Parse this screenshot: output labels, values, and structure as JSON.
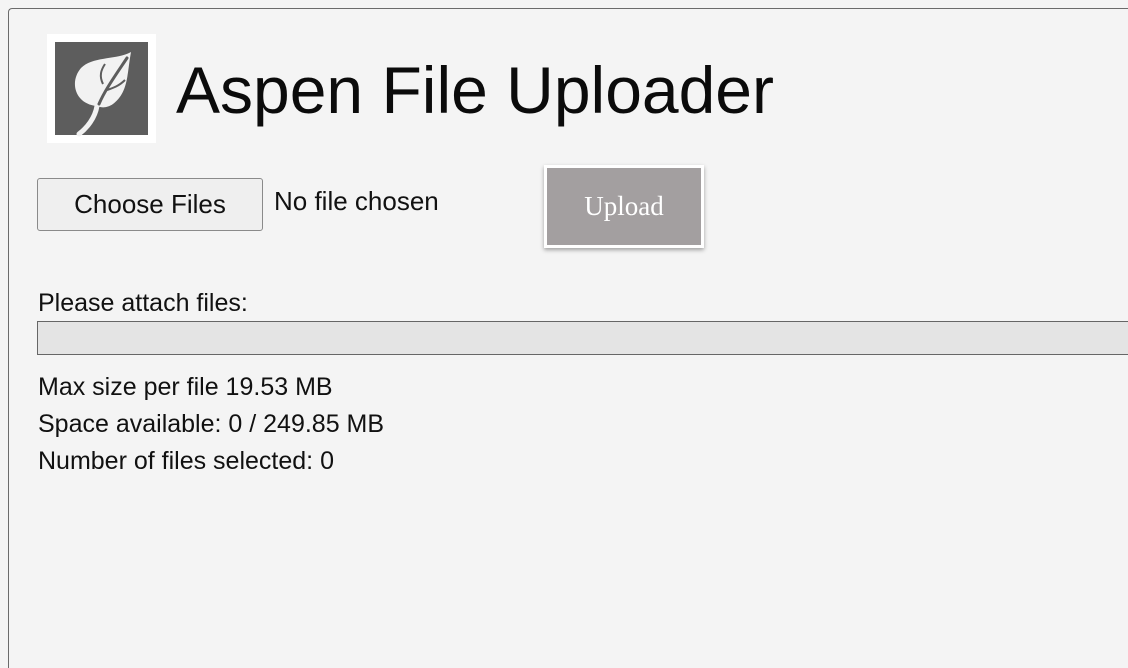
{
  "header": {
    "logo_icon": "aspen-leaf-icon",
    "title": "Aspen File Uploader"
  },
  "file_input": {
    "button_label": "Choose Files",
    "status_text": "No file chosen"
  },
  "upload_button": {
    "label": "Upload",
    "color": "#a39fa0"
  },
  "attach": {
    "label": "Please attach files:",
    "progress": 0
  },
  "info": {
    "max_size": "Max size per file 19.53 MB",
    "space_available": "Space available: 0 / 249.85 MB",
    "files_selected": "Number of files selected: 0"
  }
}
